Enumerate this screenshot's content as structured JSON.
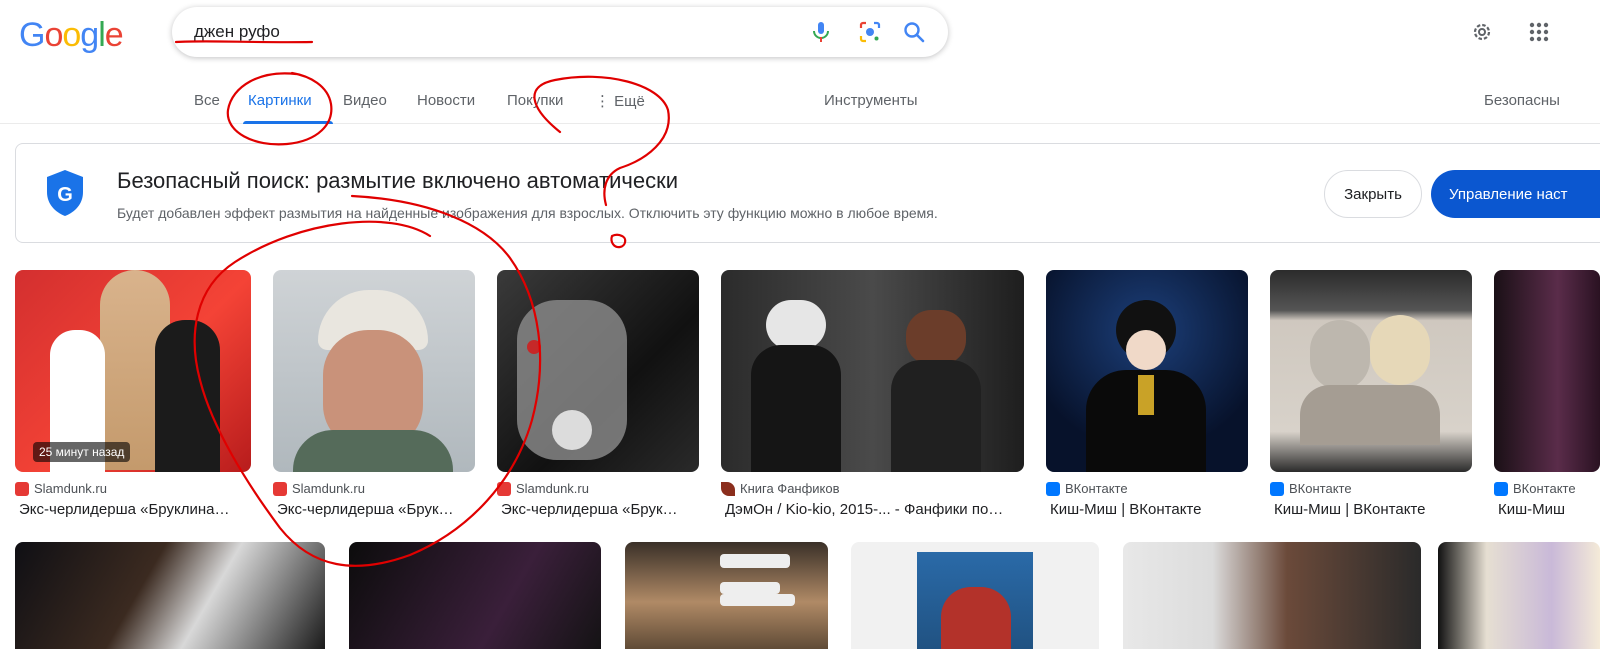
{
  "logo": {
    "letters": [
      "G",
      "o",
      "o",
      "g",
      "l",
      "e"
    ]
  },
  "search": {
    "query": "джен руфо"
  },
  "icons": {
    "mic": "microphone-icon",
    "lens": "lens-icon",
    "search": "search-icon",
    "settings": "gear-icon",
    "apps": "apps-grid-icon"
  },
  "tabs": {
    "all": "Все",
    "images": "Картинки",
    "video": "Видео",
    "news": "Новости",
    "shopping": "Покупки",
    "more": "⋮ Ещё",
    "tools": "Инструменты",
    "safesearch": "Безопасны"
  },
  "banner": {
    "title": "Безопасный поиск: размытие включено автоматически",
    "subtitle": "Будет добавлен эффект размытия на найденные изображения для взрослых. Отключить эту функцию можно в любое время.",
    "close": "Закрыть",
    "manage": "Управление наст"
  },
  "results": [
    {
      "source": "Slamdunk.ru",
      "title": "Экс-черлидерша «Бруклина…",
      "badge": "25 минут назад",
      "favicon_color": "#e53935"
    },
    {
      "source": "Slamdunk.ru",
      "title": "Экс-черлидерша «Брук…",
      "favicon_color": "#e53935"
    },
    {
      "source": "Slamdunk.ru",
      "title": "Экс-черлидерша «Брук…",
      "favicon_color": "#e53935"
    },
    {
      "source": "Книга Фанфиков",
      "title": "ДэмОн / Kio-kio, 2015-... - Фанфики по…",
      "favicon_color": "#8b2e1d"
    },
    {
      "source": "ВКонтакте",
      "title": "Киш-Миш | ВКонтакте",
      "favicon_color": "#0077ff"
    },
    {
      "source": "ВКонтакте",
      "title": "Киш-Миш | ВКонтакте",
      "favicon_color": "#0077ff"
    },
    {
      "source": "ВКонтакте",
      "title": "Киш-Миш",
      "favicon_color": "#0077ff"
    }
  ],
  "colors": {
    "accent": "#1a73e8",
    "manage_button": "#0b57d0",
    "annotation": "#e00000"
  }
}
